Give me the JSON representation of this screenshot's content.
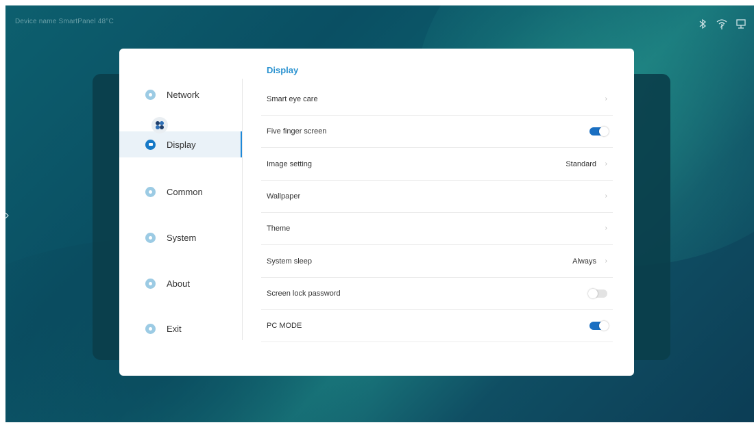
{
  "status_bar": {
    "text": "Device name   SmartPanel   48°C",
    "icons": [
      "bluetooth-icon",
      "wifi-icon",
      "screen-share-icon"
    ]
  },
  "sidebar": {
    "items": [
      {
        "label": "Network",
        "icon": "network-icon"
      },
      {
        "label": "Display",
        "icon": "display-icon",
        "active": true
      },
      {
        "label": "Common",
        "icon": "common-icon"
      },
      {
        "label": "System",
        "icon": "system-icon"
      },
      {
        "label": "About",
        "icon": "about-icon"
      },
      {
        "label": "Exit",
        "icon": "exit-icon"
      }
    ]
  },
  "main": {
    "title": "Display",
    "rows": [
      {
        "label": "Smart eye care",
        "control": "chevron"
      },
      {
        "label": "Five finger screen",
        "control": "toggle",
        "state": "on"
      },
      {
        "label": "Image setting",
        "value": "Standard",
        "control": "chevron"
      },
      {
        "label": "Wallpaper",
        "control": "chevron"
      },
      {
        "label": "Theme",
        "control": "chevron"
      },
      {
        "label": "System sleep",
        "value": "Always",
        "control": "chevron"
      },
      {
        "label": "Screen lock password",
        "control": "toggle",
        "state": "off"
      },
      {
        "label": "PC MODE",
        "control": "toggle",
        "state": "on"
      }
    ]
  },
  "colors": {
    "accent": "#1e88d8",
    "title": "#2a92d0",
    "toggle_on": "#1a6fc2",
    "background": "#0d5f6e"
  }
}
